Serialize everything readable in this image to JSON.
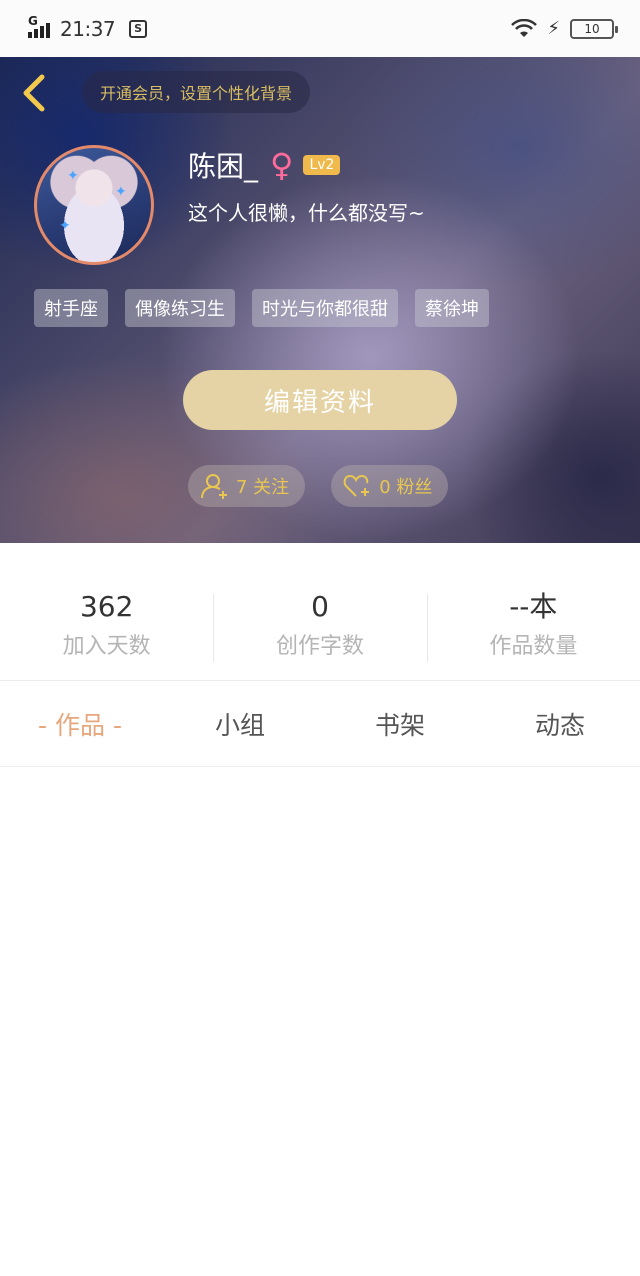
{
  "status_bar": {
    "network": "G",
    "time": "21:37",
    "battery": "10"
  },
  "header": {
    "vip_text": "开通会员，设置个性化背景",
    "name": "陈困_",
    "level": "Lv2",
    "bio": "这个人很懒，什么都没写~",
    "tags": [
      "射手座",
      "偶像练习生",
      "时光与你都很甜",
      "蔡徐坤"
    ],
    "edit_label": "编辑资料",
    "following": "7 关注",
    "followers": "0 粉丝"
  },
  "stats": [
    {
      "value": "362",
      "label": "加入天数"
    },
    {
      "value": "0",
      "label": "创作字数"
    },
    {
      "value": "--本",
      "label": "作品数量"
    }
  ],
  "tabs": [
    "- 作品 -",
    "小组",
    "书架",
    "动态"
  ],
  "colors": {
    "accent": "#e7a77c",
    "gold": "#e8c650",
    "edit_button": "#e5d3a5",
    "level_badge": "#f0b94c"
  }
}
